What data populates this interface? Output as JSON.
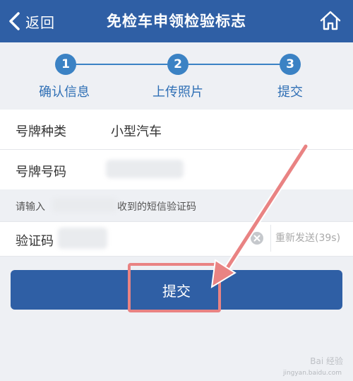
{
  "header": {
    "back_label": "返回",
    "title": "免检车申领检验标志",
    "home_icon": "home-icon"
  },
  "steps": [
    {
      "number": "1",
      "label": "确认信息"
    },
    {
      "number": "2",
      "label": "上传照片"
    },
    {
      "number": "3",
      "label": "提交"
    }
  ],
  "form": {
    "plate_type_label": "号牌种类",
    "plate_type_value": "小型汽车",
    "plate_number_label": "号牌号码",
    "hint_prefix": "请输入",
    "hint_suffix": "收到的短信验证码",
    "code_label": "验证码",
    "resend_label": "重新发送(39s)",
    "submit_label": "提交"
  },
  "watermark": {
    "text": "Bai 经验",
    "url": "jingyan.baidu.com"
  },
  "colors": {
    "header": "#2f5fa5",
    "step_accent": "#3b82c4",
    "annotation": "#e98383"
  }
}
